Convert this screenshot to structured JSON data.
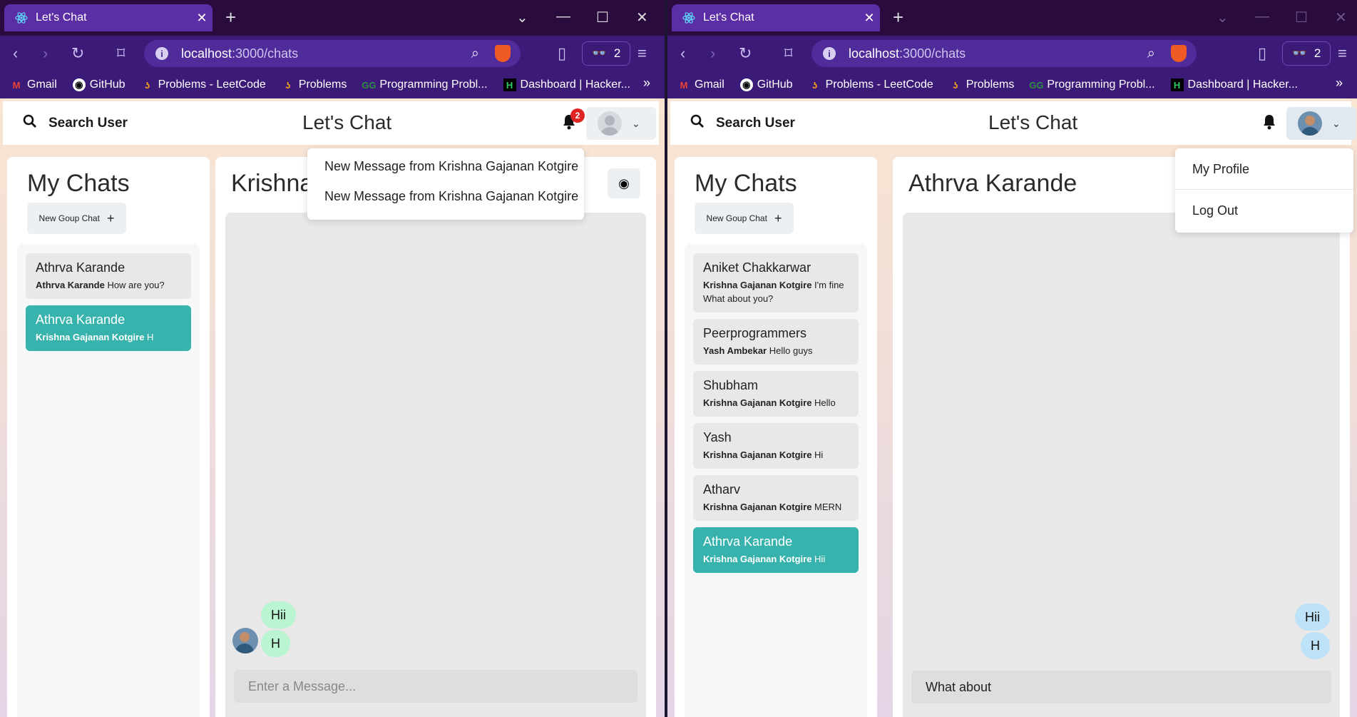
{
  "left": {
    "tab_title": "Let's Chat",
    "url_host": "localhost",
    "url_path": ":3000/chats",
    "shield_count": "2",
    "bookmarks": [
      "Gmail",
      "GitHub",
      "Problems - LeetCode",
      "Problems",
      "Programming Probl...",
      "Dashboard | Hacker..."
    ],
    "search_label": "Search User",
    "app_title": "Let's Chat",
    "notification_count": "2",
    "notifications": [
      "New Message from Krishna Gajanan Kotgire",
      "New Message from Krishna Gajanan Kotgire"
    ],
    "my_chats_title": "My Chats",
    "new_group_label": "New Goup Chat",
    "chats": [
      {
        "name": "Athrva Karande",
        "sender": "Athrva Karande",
        "text": "How are you?",
        "selected": false
      },
      {
        "name": "Athrva Karande",
        "sender": "Krishna Gajanan Kotgire",
        "text": "H",
        "selected": true
      }
    ],
    "chat_title": "Krishna Gajanan Kotgire",
    "messages": [
      "Hii",
      "H"
    ],
    "input_placeholder": "Enter a Message..."
  },
  "right": {
    "tab_title": "Let's Chat",
    "url_host": "localhost",
    "url_path": ":3000/chats",
    "shield_count": "2",
    "bookmarks": [
      "Gmail",
      "GitHub",
      "Problems - LeetCode",
      "Problems",
      "Programming Probl...",
      "Dashboard | Hacker..."
    ],
    "search_label": "Search User",
    "app_title": "Let's Chat",
    "profile_menu": [
      "My Profile",
      "Log Out"
    ],
    "my_chats_title": "My Chats",
    "new_group_label": "New Goup Chat",
    "chats": [
      {
        "name": "Aniket Chakkarwar",
        "sender": "Krishna Gajanan Kotgire",
        "text": "I'm fine What about you?",
        "selected": false
      },
      {
        "name": "Peerprogrammers",
        "sender": "Yash Ambekar",
        "text": "Hello guys",
        "selected": false
      },
      {
        "name": "Shubham",
        "sender": "Krishna Gajanan Kotgire",
        "text": "Hello",
        "selected": false
      },
      {
        "name": "Yash",
        "sender": "Krishna Gajanan Kotgire",
        "text": "Hi",
        "selected": false
      },
      {
        "name": "Atharv",
        "sender": "Krishna Gajanan Kotgire",
        "text": "MERN",
        "selected": false
      },
      {
        "name": "Athrva Karande",
        "sender": "Krishna Gajanan Kotgire",
        "text": "Hii",
        "selected": true
      }
    ],
    "chat_title": "Athrva Karande",
    "messages": [
      "Hii",
      "H"
    ],
    "input_value": "What about"
  },
  "colors": {
    "accent_selected": "#38b2ac",
    "tab_bar": "#2a0b3d",
    "toolbar": "#3b1a78",
    "badge": "#e02424",
    "bubble_received": "#b9f5d0",
    "bubble_sent": "#bee3f8"
  }
}
